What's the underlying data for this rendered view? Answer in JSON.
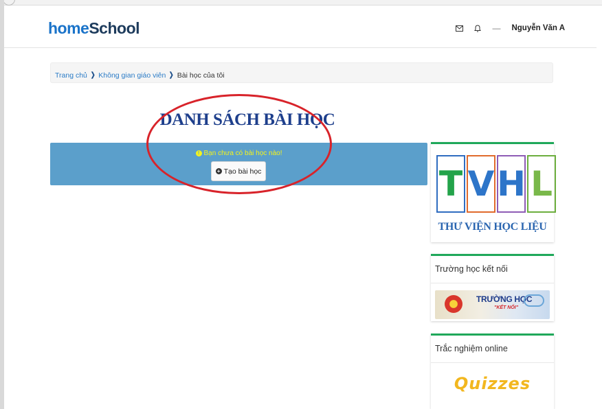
{
  "brand": {
    "part1": "home",
    "part2": "School"
  },
  "nav": {
    "mail_icon": "mail-icon",
    "bell_icon": "bell-icon",
    "dash": "—",
    "user_name": "Nguyễn Văn A"
  },
  "breadcrumb": {
    "items": [
      "Trang chủ",
      "Không gian giáo viên"
    ],
    "current": "Bài học của tôi",
    "separator_icon": "chevron-right-icon"
  },
  "page_title": "DANH SÁCH BÀI HỌC",
  "empty_state": {
    "message": "Bạn chưa có bài học nào!",
    "button_label": "Tạo bài học"
  },
  "sidebar": {
    "tvhl": {
      "letters": [
        "T",
        "V",
        "H",
        "L"
      ],
      "caption": "THƯ VIỆN HỌC LIỆU"
    },
    "ketnoi": {
      "title": "Trường học kết nối",
      "banner_main": "TRƯỜNG HỌC",
      "banner_sub": "\"KẾT NỐI\""
    },
    "quiz": {
      "title": "Trắc nghiệm online",
      "logo": "Quizzes"
    }
  },
  "colors": {
    "brand_blue": "#1a73c9",
    "panel_blue": "#5b9fcb",
    "alert_yellow": "#f4f31c",
    "widget_green": "#1fa85a",
    "annotation_red": "#d8232a",
    "title_navy": "#1e3f8c"
  }
}
